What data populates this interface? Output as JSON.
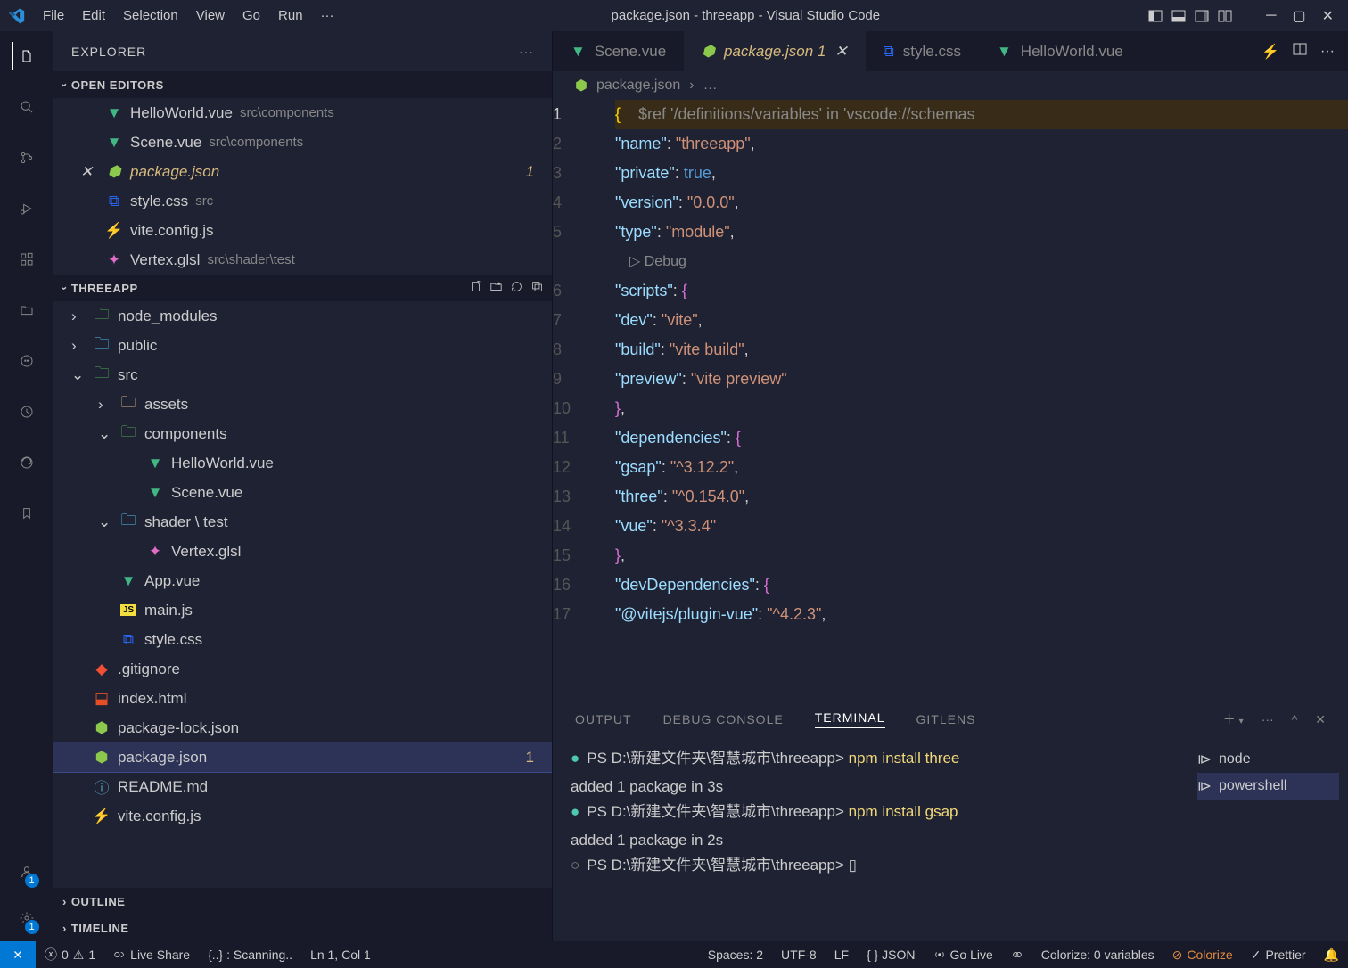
{
  "title": "package.json - threeapp - Visual Studio Code",
  "menu": [
    "File",
    "Edit",
    "Selection",
    "View",
    "Go",
    "Run",
    "···"
  ],
  "sidebar": {
    "title": "EXPLORER",
    "sections": {
      "open_editors": "OPEN EDITORS",
      "project": "THREEAPP",
      "outline": "OUTLINE",
      "timeline": "TIMELINE"
    },
    "open_editors": [
      {
        "name": "HelloWorld.vue",
        "path": "src\\components",
        "icon": "vue"
      },
      {
        "name": "Scene.vue",
        "path": "src\\components",
        "icon": "vue"
      },
      {
        "name": "package.json",
        "path": "",
        "icon": "nodejs",
        "modified": true,
        "badge": "1"
      },
      {
        "name": "style.css",
        "path": "src",
        "icon": "css"
      },
      {
        "name": "vite.config.js",
        "path": "",
        "icon": "vite"
      },
      {
        "name": "Vertex.glsl",
        "path": "src\\shader\\test",
        "icon": "glsl"
      }
    ],
    "tree": [
      {
        "type": "folder",
        "name": "node_modules",
        "indent": 1,
        "open": false,
        "color": "#4caf50"
      },
      {
        "type": "folder",
        "name": "public",
        "indent": 1,
        "open": false,
        "color": "#4fc3f7"
      },
      {
        "type": "folder",
        "name": "src",
        "indent": 1,
        "open": true,
        "color": "#4caf50"
      },
      {
        "type": "folder",
        "name": "assets",
        "indent": 2,
        "open": false,
        "color": "#dcb67a"
      },
      {
        "type": "folder",
        "name": "components",
        "indent": 2,
        "open": true,
        "color": "#4caf50"
      },
      {
        "type": "file",
        "name": "HelloWorld.vue",
        "indent": 3,
        "icon": "vue"
      },
      {
        "type": "file",
        "name": "Scene.vue",
        "indent": 3,
        "icon": "vue"
      },
      {
        "type": "folder",
        "name": "shader \\ test",
        "indent": 2,
        "open": true,
        "color": "#4fc3f7"
      },
      {
        "type": "file",
        "name": "Vertex.glsl",
        "indent": 3,
        "icon": "glsl"
      },
      {
        "type": "file",
        "name": "App.vue",
        "indent": 2,
        "icon": "vue"
      },
      {
        "type": "file",
        "name": "main.js",
        "indent": 2,
        "icon": "js"
      },
      {
        "type": "file",
        "name": "style.css",
        "indent": 2,
        "icon": "css"
      },
      {
        "type": "file",
        "name": ".gitignore",
        "indent": 1,
        "icon": "git"
      },
      {
        "type": "file",
        "name": "index.html",
        "indent": 1,
        "icon": "html"
      },
      {
        "type": "file",
        "name": "package-lock.json",
        "indent": 1,
        "icon": "nodejs"
      },
      {
        "type": "file",
        "name": "package.json",
        "indent": 1,
        "icon": "nodejs",
        "selected": true,
        "badge": "1"
      },
      {
        "type": "file",
        "name": "README.md",
        "indent": 1,
        "icon": "md"
      },
      {
        "type": "file",
        "name": "vite.config.js",
        "indent": 1,
        "icon": "vite"
      }
    ]
  },
  "tabs": [
    {
      "name": "HelloWorld.vue",
      "icon": "vue"
    },
    {
      "name": "Scene.vue",
      "icon": "vue"
    },
    {
      "name": "package.json",
      "icon": "nodejs",
      "active": true,
      "badge": "1"
    },
    {
      "name": "style.css",
      "icon": "css"
    }
  ],
  "breadcrumb": [
    "package.json",
    "…"
  ],
  "extra_code_line": {
    "n": "17",
    "indent": "    ",
    "key": "@vitejs/plugin-vue",
    "colon": ": ",
    "val": "^4.2.3",
    "tail": ","
  },
  "code": [
    {
      "n": "1",
      "hl": true,
      "raw": "{",
      "hint": "    $ref '/definitions/variables' in 'vscode://schemas"
    },
    {
      "n": "2",
      "indent": "  ",
      "key": "name",
      "colon": ": ",
      "val": "threeapp",
      "tail": ","
    },
    {
      "n": "3",
      "indent": "  ",
      "key": "private",
      "colon": ": ",
      "kw": "true",
      "tail": ","
    },
    {
      "n": "4",
      "indent": "  ",
      "key": "version",
      "colon": ": ",
      "val": "0.0.0",
      "tail": ","
    },
    {
      "n": "5",
      "indent": "  ",
      "key": "type",
      "colon": ": ",
      "val": "module",
      "tail": ","
    },
    {
      "debug": "Debug"
    },
    {
      "n": "6",
      "indent": "  ",
      "key": "scripts",
      "colon": ": ",
      "open": "{"
    },
    {
      "n": "7",
      "indent": "    ",
      "key": "dev",
      "colon": ": ",
      "val": "vite",
      "tail": ","
    },
    {
      "n": "8",
      "indent": "    ",
      "key": "build",
      "colon": ": ",
      "val": "vite build",
      "tail": ","
    },
    {
      "n": "9",
      "indent": "    ",
      "key": "preview",
      "colon": ": ",
      "val": "vite preview"
    },
    {
      "n": "10",
      "indent": "  ",
      "close": "}",
      "tail": ","
    },
    {
      "n": "11",
      "indent": "  ",
      "key": "dependencies",
      "colon": ": ",
      "open": "{"
    },
    {
      "n": "12",
      "indent": "    ",
      "key": "gsap",
      "colon": ": ",
      "val": "^3.12.2",
      "tail": ","
    },
    {
      "n": "13",
      "indent": "    ",
      "key": "three",
      "colon": ": ",
      "val": "^0.154.0",
      "tail": ","
    },
    {
      "n": "14",
      "indent": "    ",
      "key": "vue",
      "colon": ": ",
      "val": "^3.3.4"
    },
    {
      "n": "15",
      "indent": "  ",
      "close": "}",
      "tail": ","
    },
    {
      "n": "16",
      "indent": "  ",
      "key": "devDependencies",
      "colon": ": ",
      "open": "{"
    }
  ],
  "panel": {
    "tabs": [
      "OUTPUT",
      "DEBUG CONSOLE",
      "TERMINAL",
      "GITLENS"
    ],
    "active": "TERMINAL",
    "terminal": [
      {
        "class": "term-dot-cyan",
        "prompt": "PS D:\\新建文件夹\\智慧城市\\threeapp>",
        "cmd": "npm install three"
      },
      {
        "text": "added 1 package in 3s"
      },
      {
        "class": "term-dot-cyan",
        "prompt": "PS D:\\新建文件夹\\智慧城市\\threeapp>",
        "cmd": "npm install gsap"
      },
      {
        "text": "added 1 package in 2s"
      },
      {
        "class": "term-dot-grey",
        "prompt": "PS D:\\新建文件夹\\智慧城市\\threeapp>",
        "cursor": true
      }
    ],
    "side": [
      "node",
      "powershell"
    ]
  },
  "status": {
    "errors": "0",
    "warnings": "1",
    "live_share": "Live Share",
    "scanning": "{..} : Scanning..",
    "pos": "Ln 1, Col 1",
    "spaces": "Spaces: 2",
    "encoding": "UTF-8",
    "eol": "LF",
    "lang": "{ } JSON",
    "golive": "Go Live",
    "colorize_vars": "Colorize: 0 variables",
    "colorize": "Colorize",
    "prettier": "Prettier"
  },
  "badges": {
    "accounts": "1",
    "settings": "1"
  }
}
